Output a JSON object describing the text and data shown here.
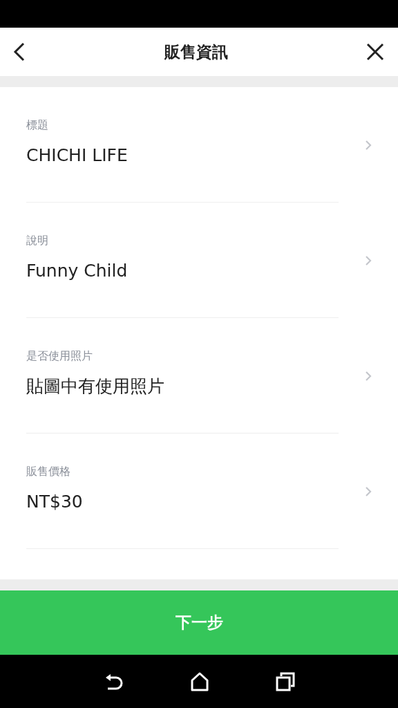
{
  "header": {
    "title": "販售資訊"
  },
  "fields": [
    {
      "label": "標題",
      "value": "CHICHI LIFE"
    },
    {
      "label": "說明",
      "value": "Funny Child"
    },
    {
      "label": "是否使用照片",
      "value": "貼圖中有使用照片"
    },
    {
      "label": "販售價格",
      "value": "NT$30"
    }
  ],
  "next_button": {
    "label": "下一步"
  }
}
